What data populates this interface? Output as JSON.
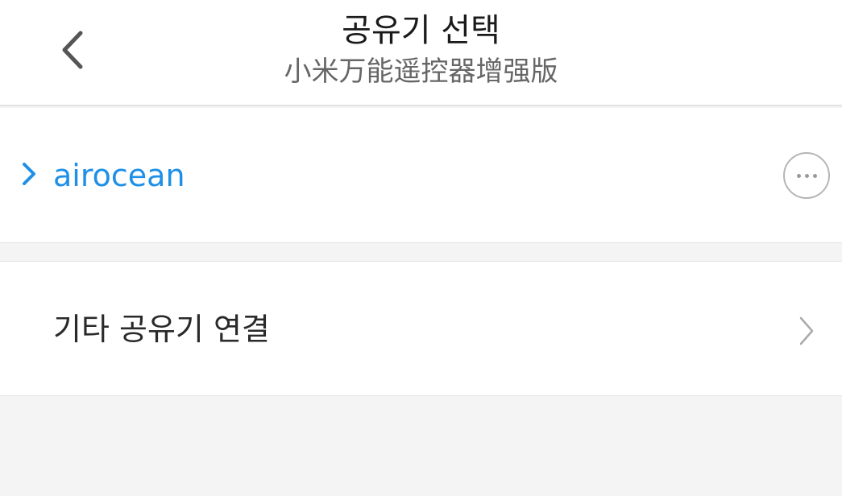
{
  "header": {
    "title": "공유기 선택",
    "subtitle": "小米万能遥控器增强版",
    "back_icon": "chevron-left-icon"
  },
  "networks": [
    {
      "name": "airocean",
      "expand_icon": "chevron-right-icon",
      "more_icon": "more-horizontal-icon"
    }
  ],
  "other": {
    "label": "기타 공유기 연결",
    "chevron_icon": "chevron-right-icon"
  },
  "colors": {
    "accent": "#1e90e8",
    "background": "#f4f4f4",
    "card": "#ffffff",
    "divider": "#e2e2e2"
  }
}
